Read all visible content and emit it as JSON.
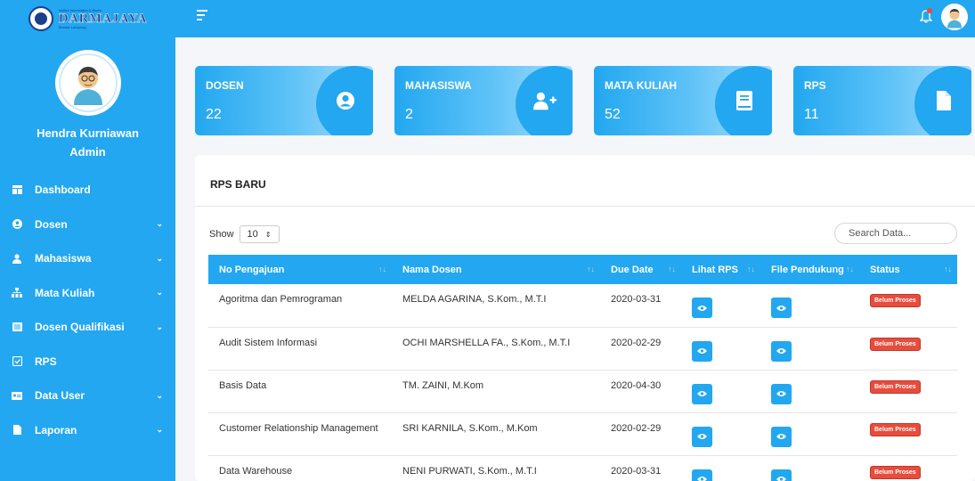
{
  "brand": {
    "top_line": "Institut Informatika & Bisnis",
    "name": "DARMAJAYA",
    "sub_line": "Bandar Lampung"
  },
  "user": {
    "name": "Hendra Kurniawan",
    "role": "Admin"
  },
  "menu": [
    {
      "label": "Dashboard",
      "icon": "dashboard-icon",
      "has_sub": false
    },
    {
      "label": "Dosen",
      "icon": "user-circle-icon",
      "has_sub": true
    },
    {
      "label": "Mahasiswa",
      "icon": "user-icon",
      "has_sub": true
    },
    {
      "label": "Mata Kuliah",
      "icon": "sitemap-icon",
      "has_sub": true
    },
    {
      "label": "Dosen Qualifikasi",
      "icon": "list-icon",
      "has_sub": true
    },
    {
      "label": "RPS",
      "icon": "check-square-icon",
      "has_sub": false
    },
    {
      "label": "Data User",
      "icon": "id-card-icon",
      "has_sub": true
    },
    {
      "label": "Laporan",
      "icon": "file-icon",
      "has_sub": true
    }
  ],
  "cards": [
    {
      "title": "DOSEN",
      "value": "22",
      "icon": "user-circle-icon"
    },
    {
      "title": "MAHASISWA",
      "value": "2",
      "icon": "user-plus-icon"
    },
    {
      "title": "MATA KULIAH",
      "value": "52",
      "icon": "book-icon"
    },
    {
      "title": "RPS",
      "value": "11",
      "icon": "file-icon"
    }
  ],
  "panel": {
    "title": "RPS BARU",
    "show_label": "Show",
    "page_size": "10",
    "search_placeholder": "Search Data..."
  },
  "table": {
    "columns": [
      "No Pengajuan",
      "Nama Dosen",
      "Due Date",
      "Lihat RPS",
      "File Pendukung",
      "Status"
    ],
    "rows": [
      {
        "no": "Agoritma dan Pemrograman",
        "dosen": "MELDA AGARINA, S.Kom., M.T.I",
        "due": "2020-03-31",
        "status": "Belum Proses"
      },
      {
        "no": "Audit Sistem Informasi",
        "dosen": "OCHI MARSHELLA FA., S.Kom., M.T.I",
        "due": "2020-02-29",
        "status": "Belum Proses"
      },
      {
        "no": "Basis Data",
        "dosen": "TM. ZAINI, M.Kom",
        "due": "2020-04-30",
        "status": "Belum Proses"
      },
      {
        "no": "Customer Relationship Management",
        "dosen": "SRI KARNILA, S.Kom., M.Kom",
        "due": "2020-02-29",
        "status": "Belum Proses"
      },
      {
        "no": "Data Warehouse",
        "dosen": "NENI PURWATI, S.Kom., M.T.I",
        "due": "2020-03-31",
        "status": "Belum Proses"
      }
    ]
  },
  "colors": {
    "primary": "#22a7f0",
    "danger": "#e74c3c"
  }
}
